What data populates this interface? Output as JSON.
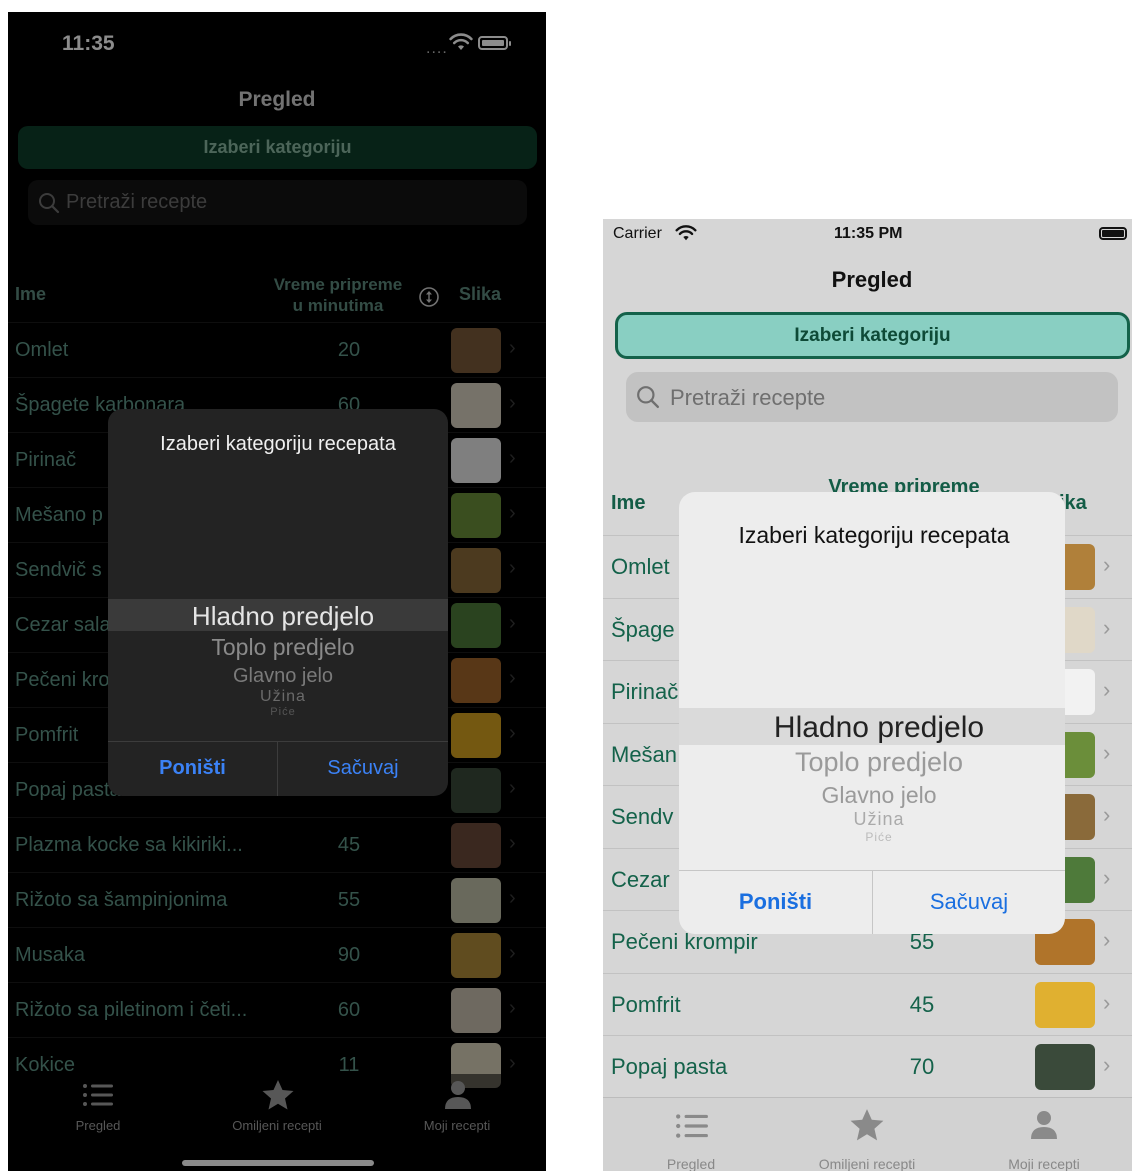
{
  "screens": [
    {
      "theme": "dark",
      "status": {
        "time": "11:35",
        "dots": "...."
      },
      "nav_title": "Pregled",
      "category_button": "Izaberi kategoriju",
      "search_placeholder": "Pretraži recepte",
      "table_headers": {
        "name": "Ime",
        "time_line1": "Vreme pripreme",
        "time_line2": "u minutima",
        "image": "Slika"
      },
      "rows": [
        {
          "name": "Omlet",
          "minutes": "20"
        },
        {
          "name": "Špagete karbonara",
          "minutes": "60"
        },
        {
          "name": "Pirinač",
          "minutes": ""
        },
        {
          "name": "Mešano p",
          "minutes": ""
        },
        {
          "name": "Sendvič s",
          "minutes": ""
        },
        {
          "name": "Cezar sala",
          "minutes": ""
        },
        {
          "name": "Pečeni kro",
          "minutes": ""
        },
        {
          "name": "Pomfrit",
          "minutes": ""
        },
        {
          "name": "Popaj pasta",
          "minutes": ""
        },
        {
          "name": "Plazma kocke sa kikiriki...",
          "minutes": "45"
        },
        {
          "name": "Rižoto sa šampinjonima",
          "minutes": "55"
        },
        {
          "name": "Musaka",
          "minutes": "90"
        },
        {
          "name": "Rižoto sa piletinom i četi...",
          "minutes": "60"
        },
        {
          "name": "Kokice",
          "minutes": "11"
        }
      ],
      "alert": {
        "title": "Izaberi kategoriju recepata",
        "picker_options": [
          "Hladno predjelo",
          "Toplo predjelo",
          "Glavno jelo",
          "Užina",
          "Piće"
        ],
        "cancel": "Poništi",
        "save": "Sačuvaj"
      },
      "tabs": [
        {
          "label": "Pregled",
          "icon": "list-icon"
        },
        {
          "label": "Omiljeni recepti",
          "icon": "star-icon"
        },
        {
          "label": "Moji recepti",
          "icon": "person-icon"
        }
      ]
    },
    {
      "theme": "light",
      "status": {
        "carrier": "Carrier",
        "time": "11:35 PM"
      },
      "nav_title": "Pregled",
      "category_button": "Izaberi kategoriju",
      "search_placeholder": "Pretraži recepte",
      "table_headers": {
        "name": "Ime",
        "time_line1": "Vreme pripreme",
        "image": "ika"
      },
      "rows": [
        {
          "name": "Omlet",
          "minutes": ""
        },
        {
          "name": "Špage",
          "minutes": ""
        },
        {
          "name": "Pirinač",
          "minutes": ""
        },
        {
          "name": "Mešan",
          "minutes": ""
        },
        {
          "name": "Sendv",
          "minutes": ""
        },
        {
          "name": "Cezar",
          "minutes": ""
        },
        {
          "name": "Pečeni krompir",
          "minutes": "55"
        },
        {
          "name": "Pomfrit",
          "minutes": "45"
        },
        {
          "name": "Popaj pasta",
          "minutes": "70"
        }
      ],
      "alert": {
        "title": "Izaberi kategoriju recepata",
        "picker_options": [
          "Hladno predjelo",
          "Toplo predjelo",
          "Glavno jelo",
          "Užina",
          "Piće"
        ],
        "cancel": "Poništi",
        "save": "Sačuvaj"
      },
      "tabs": [
        {
          "label": "Pregled",
          "icon": "list-icon"
        },
        {
          "label": "Omiljeni recepti",
          "icon": "star-icon"
        },
        {
          "label": "Moji recepti",
          "icon": "person-icon"
        }
      ]
    }
  ],
  "colors": {
    "dark_accent": "#0d3f2a",
    "dark_text": "#5f9687",
    "light_accent": "#89cfc2",
    "light_text": "#14624a",
    "button_blue": "#3b82f6"
  }
}
